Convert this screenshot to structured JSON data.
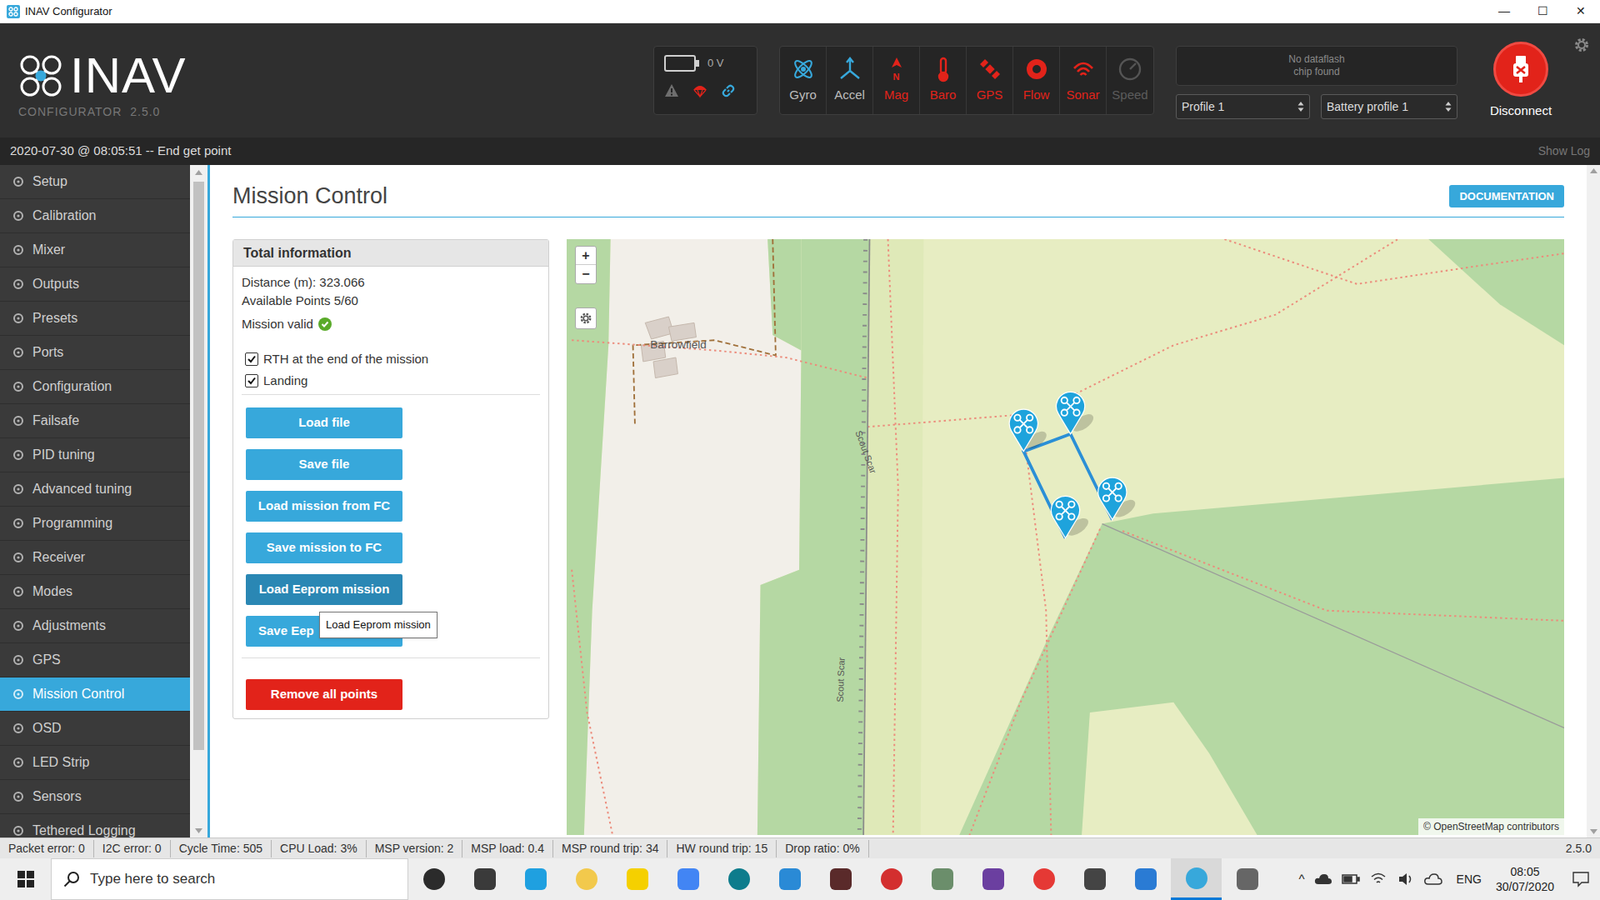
{
  "window": {
    "title": "INAV Configurator",
    "controls": [
      "—",
      "☐",
      "✕"
    ]
  },
  "header": {
    "logo": "INAV",
    "subtitle": "CONFIGURATOR",
    "version": "2.5.0",
    "battery": {
      "voltage": "0 V",
      "level": 0
    },
    "status_icons": [
      {
        "kind": "warning",
        "color": "#6e6e6e"
      },
      {
        "kind": "failsafe",
        "color": "#e2231a"
      },
      {
        "kind": "link",
        "color": "#37a8db"
      }
    ],
    "sensors": [
      {
        "label": "Gyro",
        "status": "ok"
      },
      {
        "label": "Accel",
        "status": "ok"
      },
      {
        "label": "Mag",
        "status": "error",
        "mark": "N"
      },
      {
        "label": "Baro",
        "status": "error"
      },
      {
        "label": "GPS",
        "status": "error"
      },
      {
        "label": "Flow",
        "status": "error"
      },
      {
        "label": "Sonar",
        "status": "error"
      },
      {
        "label": "Speed",
        "status": "missing"
      }
    ],
    "dataflash": [
      "No dataflash",
      "chip found"
    ],
    "profile": "Profile 1",
    "battery_profile": "Battery profile 1",
    "disconnect": "Disconnect"
  },
  "log": {
    "message": "2020-07-30 @ 08:05:51 -- End get point",
    "toggle": "Show Log"
  },
  "sidebar": {
    "items": [
      {
        "label": "Setup",
        "selected": false
      },
      {
        "label": "Calibration",
        "selected": false
      },
      {
        "label": "Mixer",
        "selected": false
      },
      {
        "label": "Outputs",
        "selected": false
      },
      {
        "label": "Presets",
        "selected": false
      },
      {
        "label": "Ports",
        "selected": false
      },
      {
        "label": "Configuration",
        "selected": false
      },
      {
        "label": "Failsafe",
        "selected": false
      },
      {
        "label": "PID tuning",
        "selected": false
      },
      {
        "label": "Advanced tuning",
        "selected": false
      },
      {
        "label": "Programming",
        "selected": false
      },
      {
        "label": "Receiver",
        "selected": false
      },
      {
        "label": "Modes",
        "selected": false
      },
      {
        "label": "Adjustments",
        "selected": false
      },
      {
        "label": "GPS",
        "selected": false
      },
      {
        "label": "Mission Control",
        "selected": true
      },
      {
        "label": "OSD",
        "selected": false
      },
      {
        "label": "LED Strip",
        "selected": false
      },
      {
        "label": "Sensors",
        "selected": false
      },
      {
        "label": "Tethered Logging",
        "selected": false
      }
    ]
  },
  "page": {
    "title": "Mission Control",
    "documentation": "DOCUMENTATION"
  },
  "panel": {
    "title": "Total information",
    "lines": [
      "Distance (m): 323.066",
      "Available Points 5/60"
    ],
    "valid": {
      "label": "Mission valid",
      "ok": true
    },
    "options": [
      {
        "label": "RTH at the end of the mission",
        "checked": true
      },
      {
        "label": "Landing",
        "checked": true
      }
    ],
    "buttons": [
      {
        "label": "Load file",
        "hovered": false
      },
      {
        "label": "Save file",
        "hovered": false
      },
      {
        "label": "Load mission from FC",
        "hovered": false
      },
      {
        "label": "Save mission to FC",
        "hovered": false
      },
      {
        "label": "Load Eeprom mission",
        "hovered": true,
        "tooltip": "Load Eeprom mission"
      },
      {
        "label": "Save Eep",
        "hovered": false
      }
    ],
    "danger_button": "Remove all points"
  },
  "map": {
    "zoom_in": "+",
    "zoom_out": "−",
    "labels": [
      {
        "text": "Barrowfield"
      },
      {
        "text": "Scout Scar"
      },
      {
        "text": "Scout Scar"
      }
    ],
    "attribution": "© OpenStreetMap contributors"
  },
  "status_bar": {
    "items": [
      "Packet error: 0",
      "I2C error: 0",
      "Cycle Time: 505",
      "CPU Load: 3%",
      "MSP version: 2",
      "MSP load: 0.4",
      "MSP round trip: 34",
      "HW round trip: 15",
      "Drop ratio: 0%"
    ],
    "version": "2.5.0"
  },
  "taskbar": {
    "search": "Type here to search",
    "apps": [
      {
        "color": "#2b2b2b",
        "active": false
      },
      {
        "color": "#3a3a3a",
        "active": false
      },
      {
        "color": "#1fa0e0",
        "active": false
      },
      {
        "color": "#f2c94c",
        "active": false
      },
      {
        "color": "#f5d000",
        "active": false
      },
      {
        "color": "#4285f4",
        "active": false
      },
      {
        "color": "#0d7c8c",
        "active": false
      },
      {
        "color": "#2a8ad6",
        "active": false
      },
      {
        "color": "#5a2a2a",
        "active": false
      },
      {
        "color": "#d32f2f",
        "active": false
      },
      {
        "color": "#6b8e6b",
        "active": false
      },
      {
        "color": "#6b3fa0",
        "active": false
      },
      {
        "color": "#e53935",
        "active": false
      },
      {
        "color": "#444444",
        "active": false
      },
      {
        "color": "#2a7bd4",
        "active": false
      },
      {
        "color": "#37a8db",
        "active": true
      },
      {
        "color": "#666666",
        "active": false
      }
    ],
    "tray": {
      "expand": "^",
      "language": "ENG",
      "time": "08:05",
      "date": "30/07/2020"
    }
  }
}
